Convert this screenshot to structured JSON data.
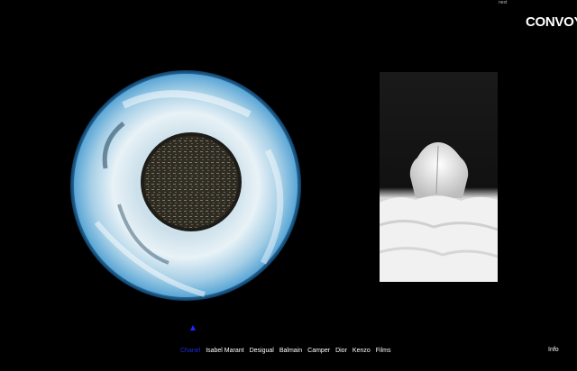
{
  "header": {
    "top_tiny_label": "next",
    "logo": "CONVOY"
  },
  "gallery": {
    "active_index": 0,
    "sphere_image_name": "ice-sphere-image",
    "figure_image_name": "white-hooded-figure-image"
  },
  "nav": {
    "items": [
      {
        "label": "Chanel",
        "active": true
      },
      {
        "label": "Isabel Marant",
        "active": false
      },
      {
        "label": "Desigual",
        "active": false
      },
      {
        "label": "Balmain",
        "active": false
      },
      {
        "label": "Camper",
        "active": false
      },
      {
        "label": "Dior",
        "active": false
      },
      {
        "label": "Kenzo",
        "active": false
      },
      {
        "label": "Films",
        "active": false
      }
    ],
    "info_label": "Info"
  },
  "colors": {
    "background": "#000000",
    "accent_active": "#1e2bd8",
    "indicator": "#1e28ff",
    "text": "#ffffff"
  }
}
